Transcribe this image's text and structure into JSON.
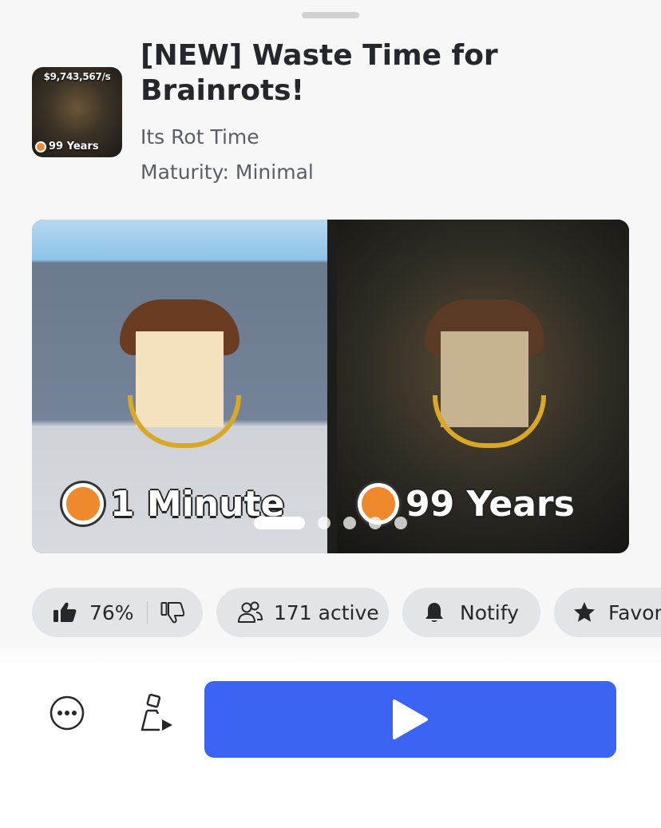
{
  "game": {
    "title": "[NEW] Waste Time for Brainrots!",
    "creator": "Its Rot Time",
    "maturity": "Maturity: Minimal"
  },
  "thumbnail": {
    "money_text": "$9,743,567/s",
    "badge_text": "99 Years"
  },
  "carousel": {
    "slide_left_caption": "1 Minute",
    "slide_right_caption": "99 Years",
    "page_count": 5,
    "active_page": 1
  },
  "chips": {
    "rating": "76%",
    "active_players": "171 active",
    "notify": "Notify",
    "favorite": "Favorite"
  },
  "icons": {
    "thumbs_up": "thumbs-up-icon",
    "thumbs_down": "thumbs-down-icon",
    "people": "people-icon",
    "bell": "bell-icon",
    "star": "star-icon",
    "more": "more-icon",
    "avatar": "avatar-icon",
    "play": "play-icon"
  },
  "colors": {
    "primary": "#3b64f5",
    "chip_bg": "#e3e4e8",
    "text": "#25272c",
    "secondary_text": "#5b5e66"
  }
}
